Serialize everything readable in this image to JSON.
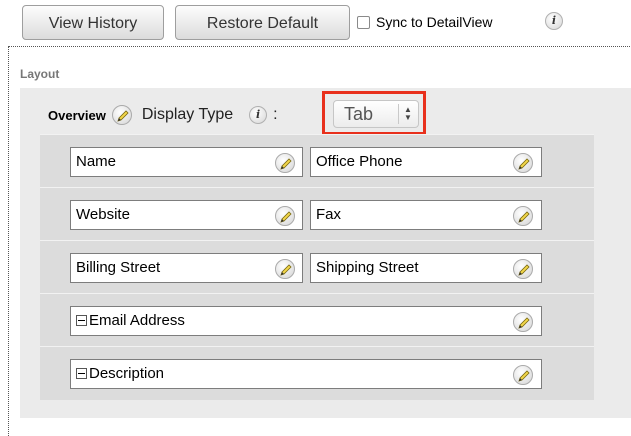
{
  "toolbar": {
    "view_history": "View History",
    "restore_default": "Restore Default",
    "sync_label": "Sync to DetailView",
    "sync_checked": false,
    "info_glyph": "i"
  },
  "layout": {
    "section_label": "Layout",
    "panel_title": "Overview",
    "display_type_label": "Display Type",
    "colon": ":",
    "display_type_value": "Tab",
    "select_arrows": "▲▼"
  },
  "fields": {
    "row1": {
      "left": "Name",
      "right": "Office Phone"
    },
    "row2": {
      "left": "Website",
      "right": "Fax"
    },
    "row3": {
      "left": "Billing Street",
      "right": "Shipping Street"
    },
    "row4": {
      "full": "Email Address"
    },
    "row5": {
      "full": "Description"
    }
  },
  "colors": {
    "highlight": "#e8301c",
    "panel_bg": "#ebebeb",
    "row_bg": "#dcdcdc"
  },
  "icons": [
    "info-icon",
    "pencil-icon",
    "minus-icon",
    "checkbox"
  ]
}
